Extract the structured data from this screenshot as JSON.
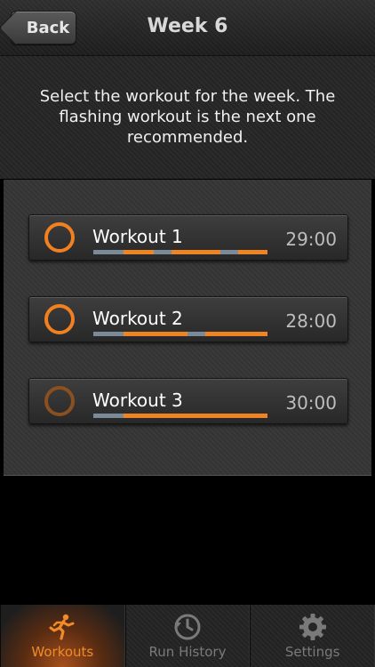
{
  "header": {
    "back_label": "Back",
    "title": "Week 6"
  },
  "intro": {
    "text": "Select the workout for the week. The flashing workout is the next one recommended."
  },
  "workouts": [
    {
      "name": "Workout 1",
      "duration": "29:00",
      "segments": [
        "walk",
        "run",
        "walk",
        "run",
        "walk",
        "run"
      ]
    },
    {
      "name": "Workout 2",
      "duration": "28:00",
      "segments": [
        "walk",
        "run",
        "walk",
        "run"
      ]
    },
    {
      "name": "Workout 3",
      "duration": "30:00",
      "segments": [
        "walk",
        "run"
      ]
    }
  ],
  "tabbar": {
    "tabs": [
      {
        "label": "Workouts",
        "icon": "runner-icon",
        "active": true
      },
      {
        "label": "Run History",
        "icon": "history-clock-icon",
        "active": false
      },
      {
        "label": "Settings",
        "icon": "gear-icon",
        "active": false
      }
    ]
  },
  "colors": {
    "accent": "#f08020",
    "walk_segment": "#7a8a99",
    "run_segment": "#ef8424"
  }
}
